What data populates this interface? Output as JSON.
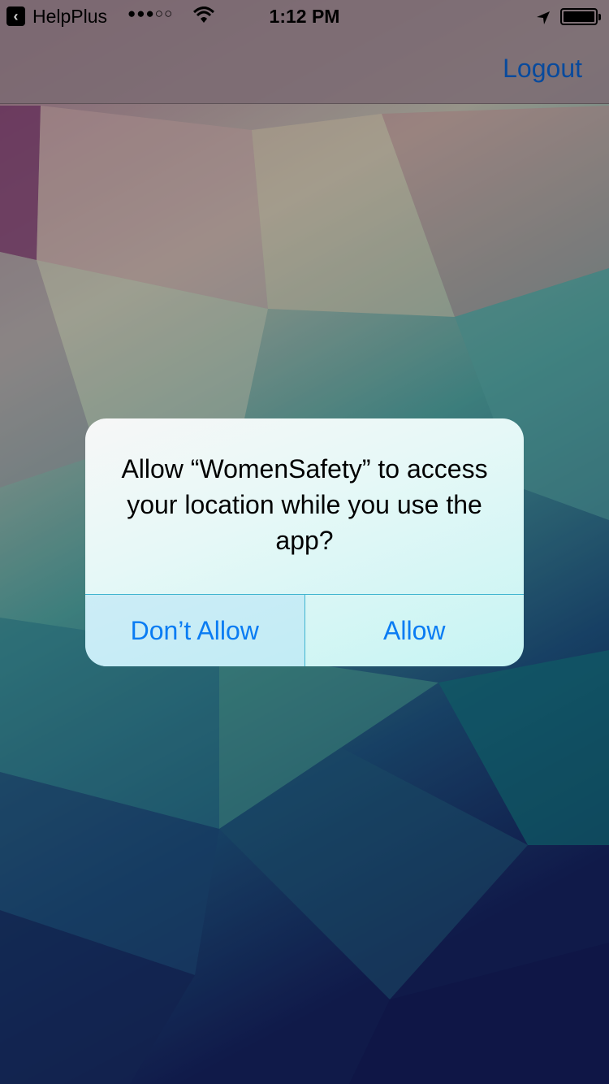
{
  "status_bar": {
    "back_app": "HelpPlus",
    "signal": "●●●○○",
    "time": "1:12 PM"
  },
  "nav": {
    "logout_label": "Logout"
  },
  "alert": {
    "message": "Allow “WomenSafety” to access your location while you use the app?",
    "deny_label": "Don’t Allow",
    "allow_label": "Allow"
  },
  "colors": {
    "accent": "#0a7cf3",
    "nav_link": "#0a5bc0"
  }
}
